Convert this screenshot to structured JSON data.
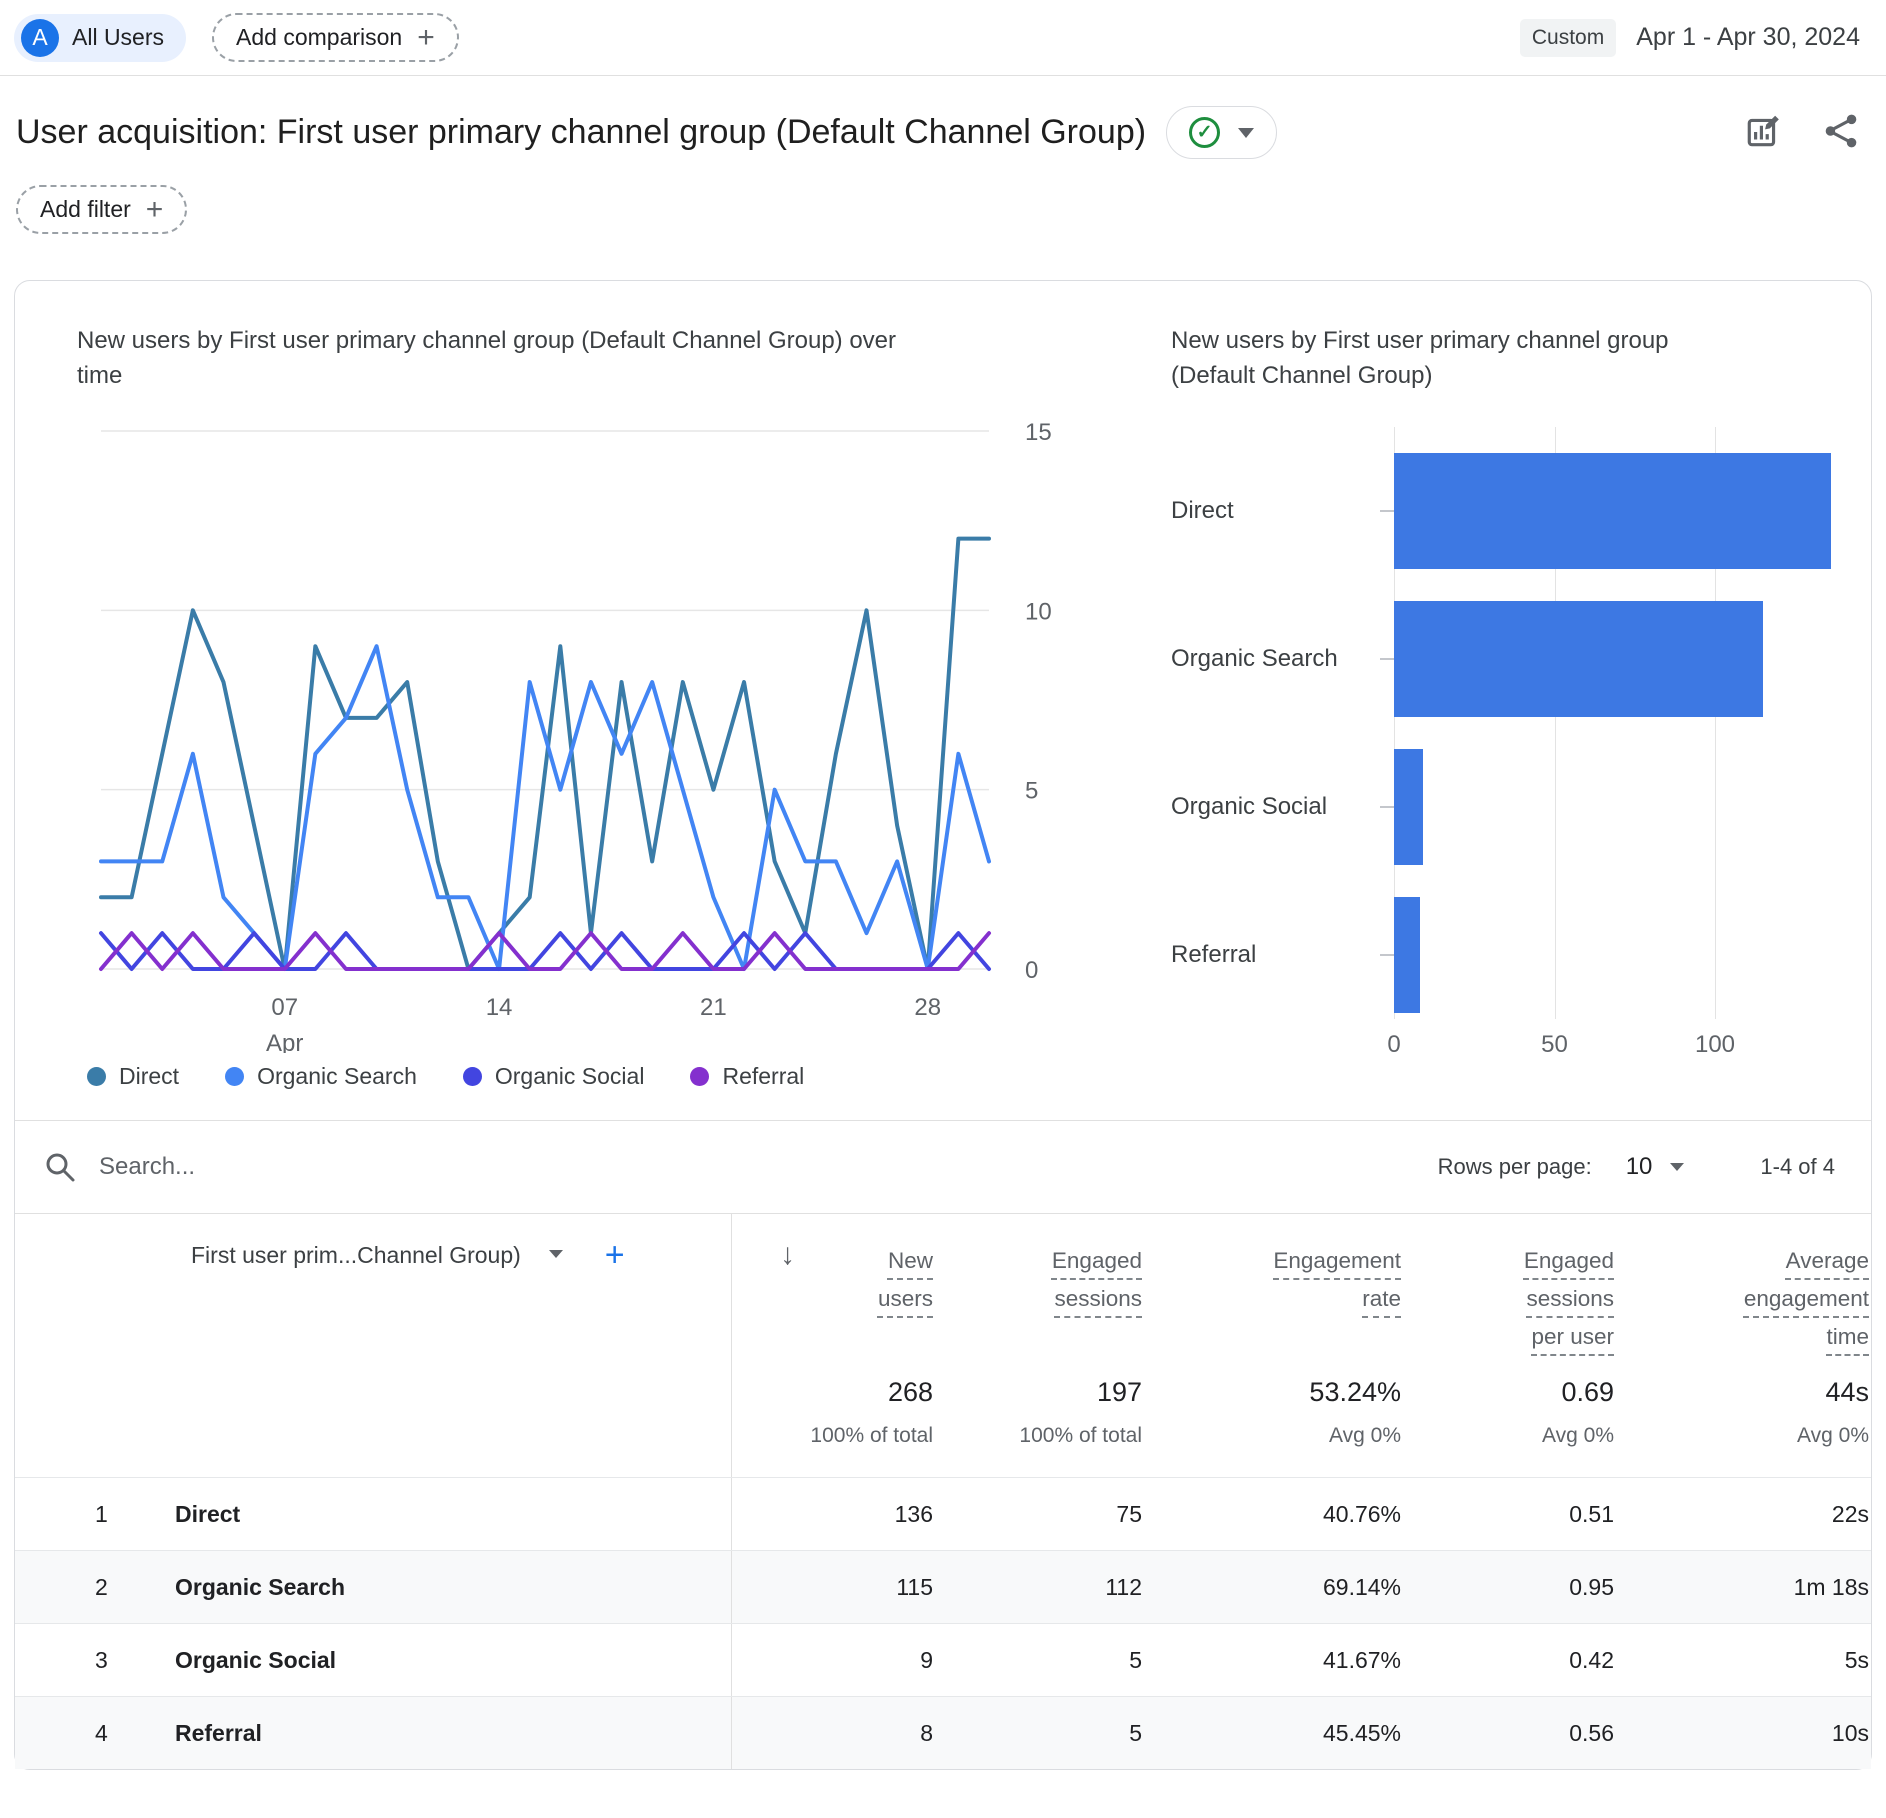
{
  "topbar": {
    "avatar_letter": "A",
    "segment_label": "All Users",
    "add_comparison_label": "Add comparison",
    "plus_symbol": "+",
    "date_range_type": "Custom",
    "date_range": "Apr 1 - Apr 30, 2024"
  },
  "header": {
    "title": "User acquisition: First user primary channel group (Default Channel Group)",
    "approved_check": "✓",
    "add_filter_label": "Add filter",
    "plus_symbol": "+"
  },
  "colors": {
    "accent_blue": "#1a73e8",
    "check_green": "#1e8e3e",
    "bar_fill": "#3d78e3",
    "grid_gray": "#e6e6e6"
  },
  "chart_data": [
    {
      "type": "line",
      "title": "New users by First user primary channel group (Default Channel Group) over time",
      "x_unit": "day of April 2024",
      "xlim": [
        1,
        30
      ],
      "ylim": [
        0,
        15
      ],
      "yticks": [
        0,
        5,
        10,
        15
      ],
      "xticks": [
        {
          "day": 7,
          "label": "07",
          "sublabel": "Apr"
        },
        {
          "day": 14,
          "label": "14"
        },
        {
          "day": 21,
          "label": "21"
        },
        {
          "day": 28,
          "label": "28"
        }
      ],
      "grid": "horizontal",
      "legend_position": "bottom",
      "series": [
        {
          "name": "Direct",
          "color": "#3a7ca8",
          "values": [
            2,
            2,
            6,
            10,
            8,
            4,
            0,
            9,
            7,
            7,
            8,
            3,
            0,
            1,
            2,
            9,
            1,
            8,
            3,
            8,
            5,
            8,
            3,
            1,
            6,
            10,
            4,
            0,
            12,
            12
          ]
        },
        {
          "name": "Organic Search",
          "color": "#4285f4",
          "values": [
            3,
            3,
            3,
            6,
            2,
            1,
            0,
            6,
            7,
            9,
            5,
            2,
            2,
            0,
            8,
            5,
            8,
            6,
            8,
            5,
            2,
            0,
            5,
            3,
            3,
            1,
            3,
            0,
            6,
            3
          ]
        },
        {
          "name": "Organic Social",
          "color": "#4245e0",
          "values": [
            1,
            0,
            1,
            0,
            0,
            1,
            0,
            0,
            1,
            0,
            0,
            0,
            0,
            0,
            0,
            1,
            0,
            1,
            0,
            0,
            0,
            1,
            0,
            1,
            0,
            0,
            0,
            0,
            1,
            0
          ]
        },
        {
          "name": "Referral",
          "color": "#8430ce",
          "values": [
            0,
            1,
            0,
            1,
            0,
            0,
            0,
            1,
            0,
            0,
            0,
            0,
            0,
            1,
            0,
            0,
            1,
            0,
            0,
            1,
            0,
            0,
            1,
            0,
            0,
            0,
            0,
            0,
            0,
            1
          ]
        }
      ]
    },
    {
      "type": "bar",
      "orientation": "horizontal",
      "title": "New users by First user primary channel group (Default Channel Group)",
      "categories": [
        "Direct",
        "Organic Search",
        "Organic Social",
        "Referral"
      ],
      "values": [
        136,
        115,
        9,
        8
      ],
      "xticks": [
        0,
        50,
        100
      ],
      "xlim": [
        0,
        145
      ],
      "bar_color": "#3d78e3",
      "grid": "vertical"
    }
  ],
  "table": {
    "search_placeholder": "Search...",
    "rows_per_page_label": "Rows per page:",
    "rows_per_page_value": "10",
    "range_label": "1-4 of 4",
    "dimension_header": "First user prim...Channel Group)",
    "sort_arrow": "↓",
    "add_column_symbol": "+",
    "columns": [
      {
        "label": "New\nusers"
      },
      {
        "label": "Engaged\nsessions"
      },
      {
        "label": "Engagement\nrate"
      },
      {
        "label": "Engaged\nsessions\nper user"
      },
      {
        "label": "Average\nengagement\ntime"
      }
    ],
    "totals": [
      {
        "value": "268",
        "sub": "100% of total"
      },
      {
        "value": "197",
        "sub": "100% of total"
      },
      {
        "value": "53.24%",
        "sub": "Avg 0%"
      },
      {
        "value": "0.69",
        "sub": "Avg 0%"
      },
      {
        "value": "44s",
        "sub": "Avg 0%"
      }
    ],
    "rows": [
      {
        "index": "1",
        "channel": "Direct",
        "values": [
          "136",
          "75",
          "40.76%",
          "0.51",
          "22s"
        ]
      },
      {
        "index": "2",
        "channel": "Organic Search",
        "values": [
          "115",
          "112",
          "69.14%",
          "0.95",
          "1m 18s"
        ]
      },
      {
        "index": "3",
        "channel": "Organic Social",
        "values": [
          "9",
          "5",
          "41.67%",
          "0.42",
          "5s"
        ]
      },
      {
        "index": "4",
        "channel": "Referral",
        "values": [
          "8",
          "5",
          "45.45%",
          "0.56",
          "10s"
        ]
      }
    ]
  }
}
